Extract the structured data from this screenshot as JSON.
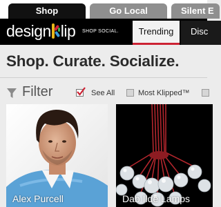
{
  "site_tabs": [
    {
      "label": "Shop",
      "active": true
    },
    {
      "label": "Go Local",
      "active": false
    },
    {
      "label": "Silent E",
      "active": false
    }
  ],
  "header": {
    "logo": {
      "prefix": "design",
      "suffix": "lip"
    },
    "tagline": "SHOP SOCIAL.",
    "nav": [
      {
        "label": "Trending",
        "active": true
      },
      {
        "label": "Disc",
        "active": false
      }
    ],
    "accent_color": "#cc2233"
  },
  "headline": "Shop. Curate. Socialize.",
  "filter": {
    "label": "Filter",
    "options": [
      {
        "label": "See All",
        "checked": true
      },
      {
        "label": "Most Klipped™",
        "checked": false
      },
      {
        "label": "",
        "checked": false
      }
    ]
  },
  "cards": [
    {
      "caption": "Alex Purcell",
      "image": "man-in-blue-sweater"
    },
    {
      "caption": "Dab Ilde Lamps",
      "image": "bulb-chandelier"
    }
  ]
}
